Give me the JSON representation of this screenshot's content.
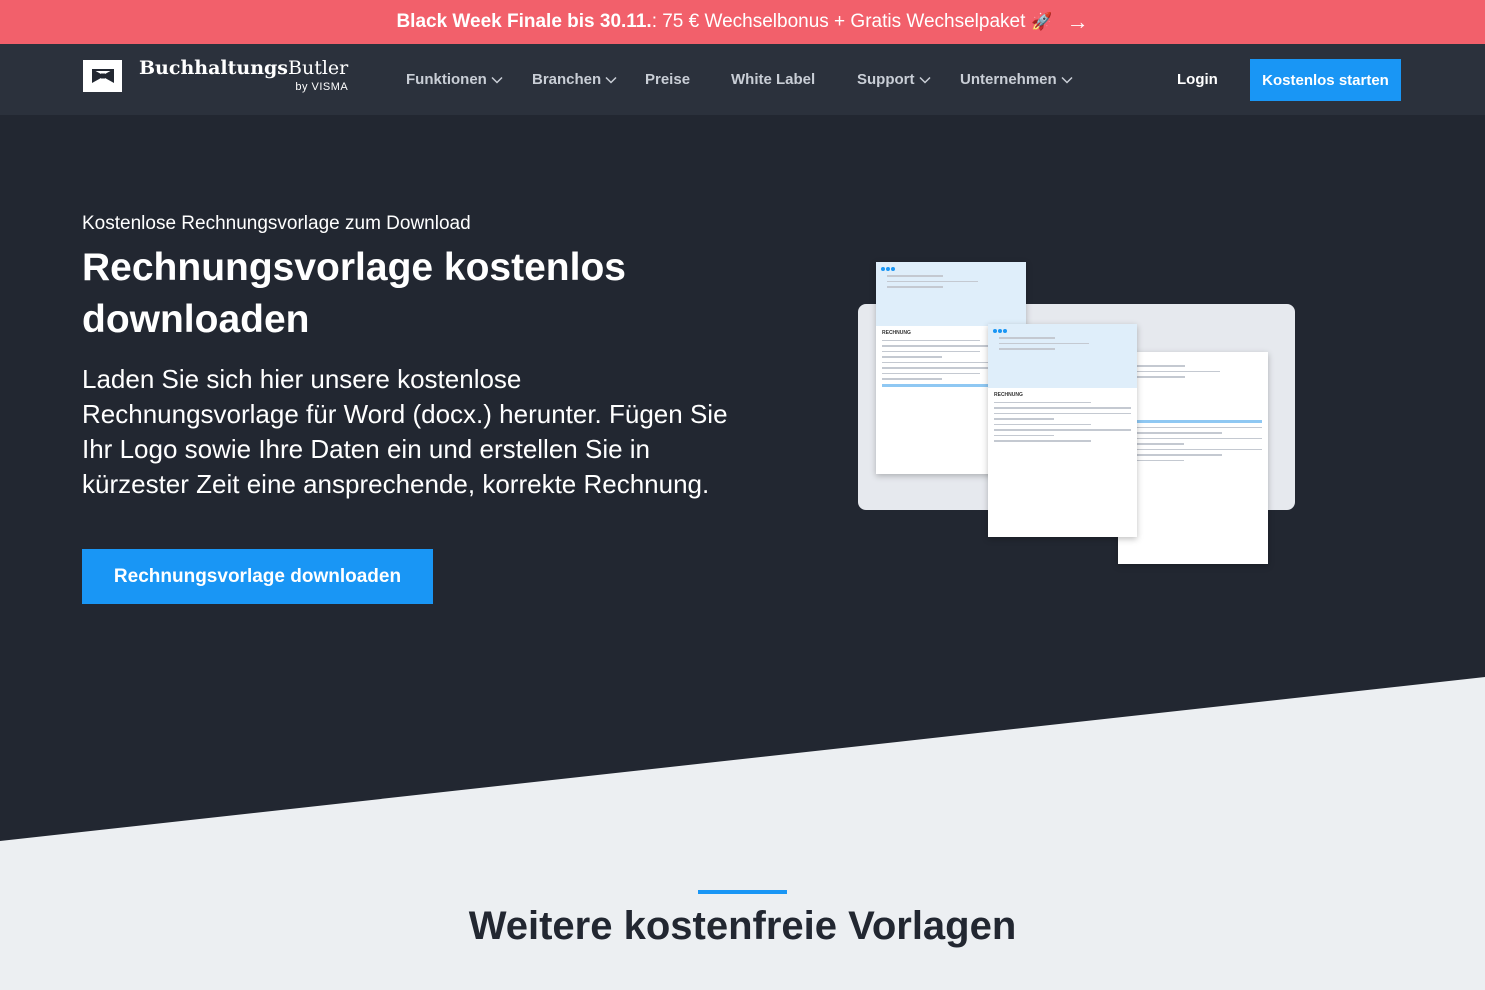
{
  "promo": {
    "bold": "Black Week Finale bis 30.11.",
    "text": ": 75 € Wechselbonus + Gratis Wechselpaket",
    "rocket": "🚀",
    "arrow": "→"
  },
  "nav": {
    "brand": {
      "name_bold": "Buchhaltungs",
      "name_regular": "Butler",
      "sub": "by VISMA"
    },
    "items": [
      {
        "label": "Funktionen"
      },
      {
        "label": "Branchen"
      },
      {
        "label": "Preise"
      },
      {
        "label": "White Label"
      },
      {
        "label": "Support"
      },
      {
        "label": "Unternehmen"
      }
    ],
    "login": "Login",
    "cta": "Kostenlos starten"
  },
  "hero": {
    "eyebrow": "Kostenlose Rechnungsvorlage zum Download",
    "title": "Rechnungsvorlage kostenlos downloaden",
    "description": "Laden Sie sich hier unsere kostenlose Rechnungsvorlage für Word (docx.) herunter. Fügen Sie Ihr Logo sowie Ihre Daten ein und erstellen Sie in kürzester Zeit eine ansprechende, korrekte Rechnung.",
    "cta": "Rechnungsvorlage downloaden",
    "doc_title": "RECHNUNG"
  },
  "section": {
    "title": "Weitere kostenfreie Vorlagen"
  },
  "colors": {
    "accent": "#1996f5",
    "promo": "#f2606b",
    "nav": "#2b313c",
    "hero": "#222731"
  }
}
